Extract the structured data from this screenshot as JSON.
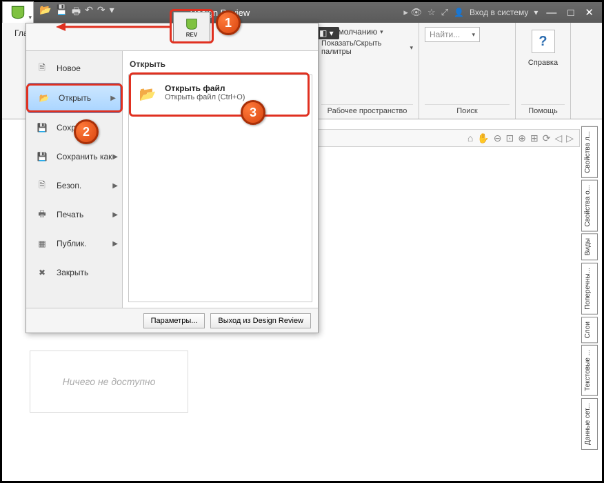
{
  "titlebar": {
    "app_name": "Design Review",
    "login": "Вход в систему",
    "rev_label": "REV"
  },
  "ribbon": {
    "home_tab": "Главная",
    "group_workspace": {
      "default": "По умолчанию",
      "toggle_palettes": "Показать/Скрыть палитры",
      "workspace": "Рабочее пространство"
    },
    "group_search": {
      "find_placeholder": "Найти...",
      "label": "Поиск"
    },
    "group_help": {
      "help": "Справка",
      "label": "Помощь"
    }
  },
  "appmenu": {
    "items": [
      {
        "label": "Новое",
        "icon": "file"
      },
      {
        "label": "Открыть",
        "icon": "folder",
        "selected": true,
        "arrow": true
      },
      {
        "label": "Сохранить",
        "icon": "save"
      },
      {
        "label": "Сохранить как",
        "icon": "save-as",
        "arrow": true
      },
      {
        "label": "Безоп.",
        "icon": "secure",
        "arrow": true
      },
      {
        "label": "Печать",
        "icon": "print",
        "arrow": true
      },
      {
        "label": "Публик.",
        "icon": "publish",
        "arrow": true
      },
      {
        "label": "Закрыть",
        "icon": "close"
      }
    ],
    "right_title": "Открыть",
    "sub": {
      "title": "Открыть файл",
      "subtitle": "Открыть файл (Ctrl+O)"
    },
    "footer": {
      "options": "Параметры...",
      "exit": "Выход из Design Review"
    }
  },
  "left_panel": {
    "empty": "Ничего не доступно"
  },
  "right_tabs": [
    "Свойства л...",
    "Свойства о...",
    "Виды",
    "Поперечны...",
    "Слои",
    "Текстовые ...",
    "Данные сет..."
  ],
  "steps": {
    "s1": "1",
    "s2": "2",
    "s3": "3"
  }
}
